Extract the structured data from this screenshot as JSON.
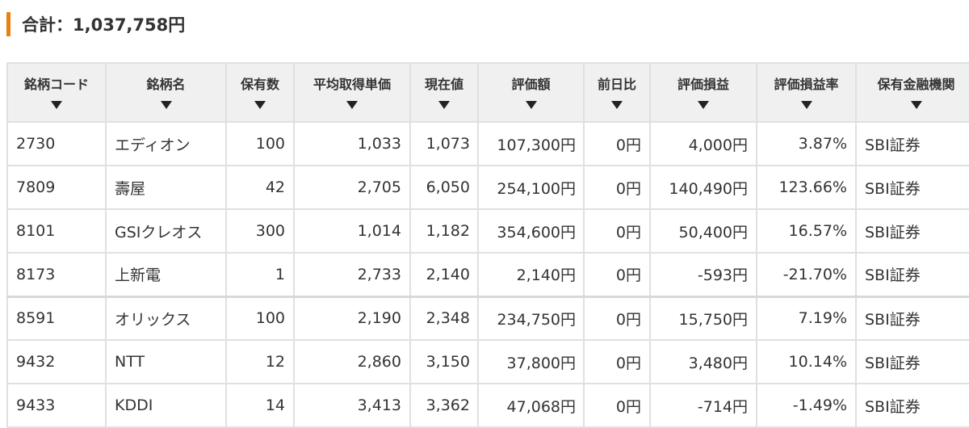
{
  "summary": {
    "total_label": "合計：1,037,758円"
  },
  "colors": {
    "accent": "#e8820c",
    "positive": "#4a78a8",
    "negative": "#b5504a",
    "header_bg": "#f0f0f0",
    "border": "#e0e0e0"
  },
  "table": {
    "headers": {
      "code": "銘柄コード",
      "name": "銘柄名",
      "quantity": "保有数",
      "avg_cost": "平均取得単価",
      "price": "現在値",
      "value": "評価額",
      "day_change": "前日比",
      "pnl": "評価損益",
      "pnl_rate": "評価損益率",
      "broker": "保有金融機関"
    },
    "sort_icon": "caret-down-icon",
    "rows": [
      {
        "code": "2730",
        "name": "エディオン",
        "quantity": "100",
        "avg_cost": "1,033",
        "price": "1,073",
        "value": "107,300円",
        "day_change": "0円",
        "pnl": "4,000円",
        "pnl_rate": "3.87%",
        "broker": "SBI証券"
      },
      {
        "code": "7809",
        "name": "壽屋",
        "quantity": "42",
        "avg_cost": "2,705",
        "price": "6,050",
        "value": "254,100円",
        "day_change": "0円",
        "pnl": "140,490円",
        "pnl_rate": "123.66%",
        "broker": "SBI証券"
      },
      {
        "code": "8101",
        "name": "GSIクレオス",
        "quantity": "300",
        "avg_cost": "1,014",
        "price": "1,182",
        "value": "354,600円",
        "day_change": "0円",
        "pnl": "50,400円",
        "pnl_rate": "16.57%",
        "broker": "SBI証券"
      },
      {
        "code": "8173",
        "name": "上新電",
        "quantity": "1",
        "avg_cost": "2,733",
        "price": "2,140",
        "value": "2,140円",
        "day_change": "0円",
        "pnl": "-593円",
        "pnl_rate": "-21.70%",
        "broker": "SBI証券"
      },
      {
        "code": "8591",
        "name": "オリックス",
        "quantity": "100",
        "avg_cost": "2,190",
        "price": "2,348",
        "value": "234,750円",
        "day_change": "0円",
        "pnl": "15,750円",
        "pnl_rate": "7.19%",
        "broker": "SBI証券"
      },
      {
        "code": "9432",
        "name": "NTT",
        "quantity": "12",
        "avg_cost": "2,860",
        "price": "3,150",
        "value": "37,800円",
        "day_change": "0円",
        "pnl": "3,480円",
        "pnl_rate": "10.14%",
        "broker": "SBI証券"
      },
      {
        "code": "9433",
        "name": "KDDI",
        "quantity": "14",
        "avg_cost": "3,413",
        "price": "3,362",
        "value": "47,068円",
        "day_change": "0円",
        "pnl": "-714円",
        "pnl_rate": "-1.49%",
        "broker": "SBI証券"
      }
    ]
  }
}
